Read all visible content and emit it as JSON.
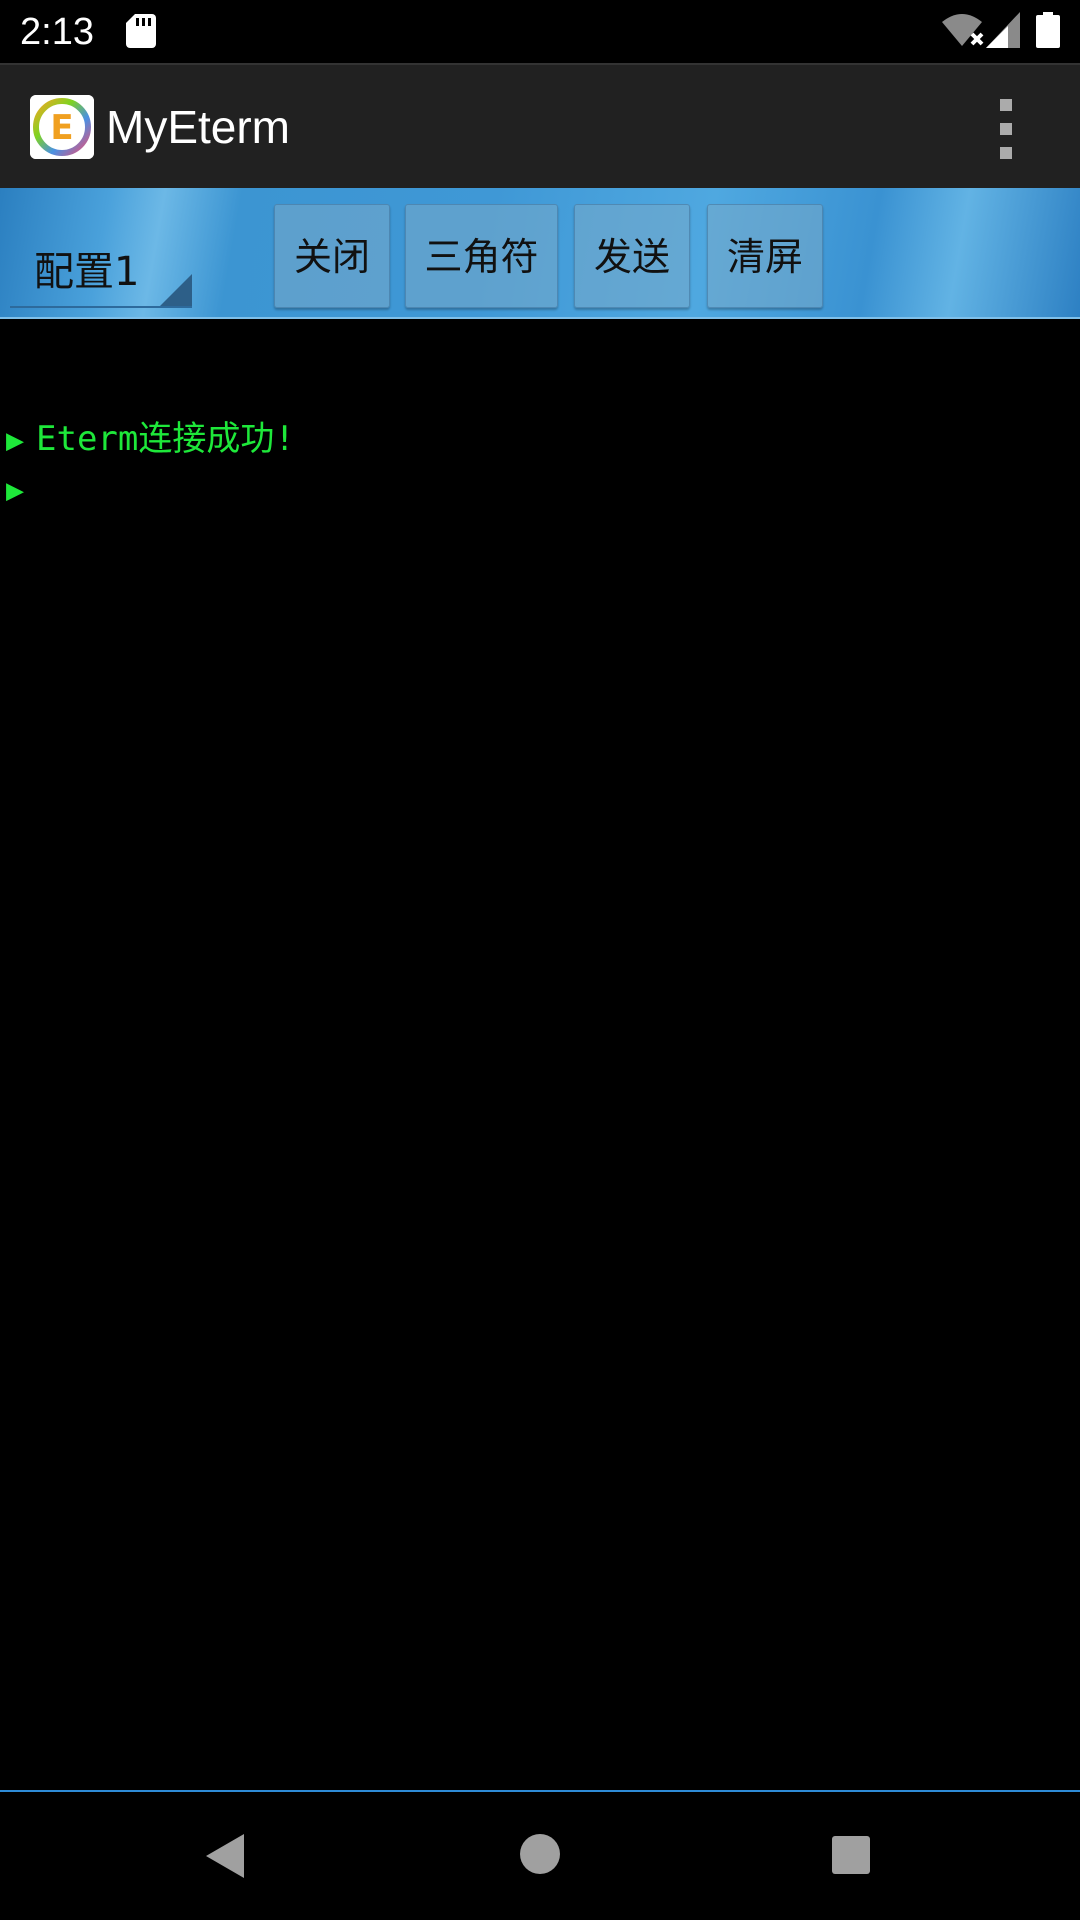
{
  "status_bar": {
    "time": "2:13",
    "icons": [
      "sd-card-icon",
      "wifi-no-internet-icon",
      "cell-signal-icon",
      "battery-icon"
    ]
  },
  "app_bar": {
    "title": "MyEterm",
    "logo_letter": "E",
    "overflow_icon": "more-vert-icon"
  },
  "toolbar": {
    "config_selected": "配置1",
    "buttons": [
      "关闭",
      "三角符",
      "发送",
      "清屏"
    ]
  },
  "terminal": {
    "prompt_symbol": "▶",
    "lines": [
      "Eterm连接成功!",
      ""
    ],
    "text_color": "#1ee83a",
    "background": "#000000"
  },
  "nav_bar": {
    "icons": [
      "back-icon",
      "home-icon",
      "recents-icon"
    ]
  },
  "colors": {
    "toolbar_blue": "#3f98d6",
    "app_bar_bg": "#212121",
    "accent_line": "#2e8bd6"
  }
}
